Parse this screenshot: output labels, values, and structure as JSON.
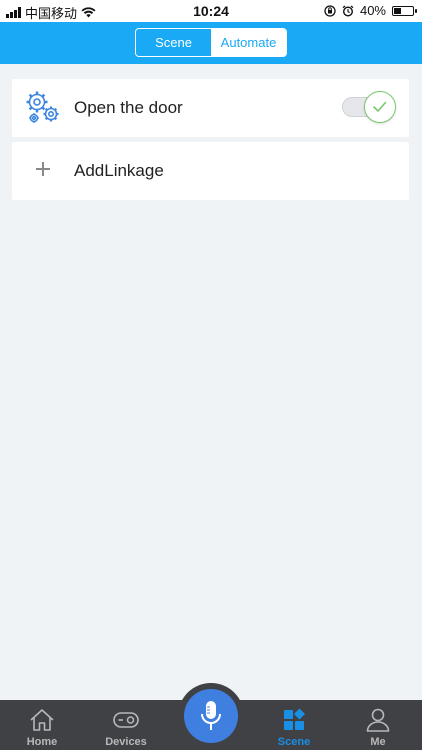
{
  "status": {
    "carrier": "中国移动",
    "time": "10:24",
    "battery": "40%",
    "battery_level": 0.4
  },
  "header": {
    "tabs": [
      {
        "label": "Scene",
        "active": false
      },
      {
        "label": "Automate",
        "active": true
      }
    ]
  },
  "automations": [
    {
      "label": "Open the door",
      "enabled": true,
      "icon": "gears-icon"
    }
  ],
  "add_linkage": {
    "label": "AddLinkage",
    "icon": "plus-icon"
  },
  "tabbar": {
    "items": [
      {
        "label": "Home",
        "icon": "home-icon",
        "active": false
      },
      {
        "label": "Devices",
        "icon": "devices-icon",
        "active": false
      },
      {
        "label": "Scene",
        "icon": "scene-icon",
        "active": true
      },
      {
        "label": "Me",
        "icon": "person-icon",
        "active": false
      }
    ],
    "center": {
      "icon": "microphone-icon"
    }
  },
  "colors": {
    "header": "#1aa9f5",
    "tabbar": "#404144",
    "active_tab": "#1a8fe6",
    "mic": "#3f7fe0",
    "toggle_on": "#7bc96f"
  }
}
